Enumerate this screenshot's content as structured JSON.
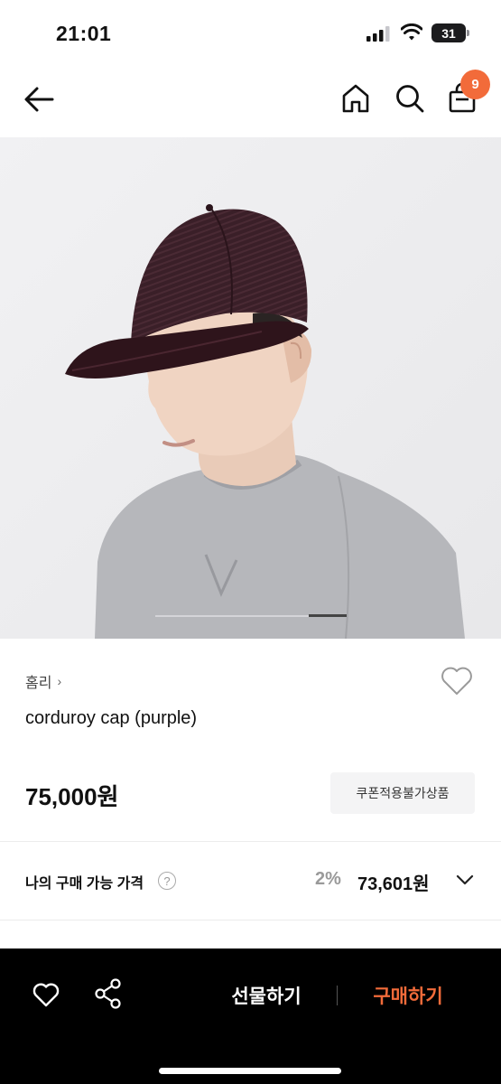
{
  "status_bar": {
    "time": "21:01",
    "battery": "31",
    "icons": [
      "signal-icon",
      "wifi-icon",
      "battery-icon"
    ]
  },
  "nav": {
    "icons": [
      "back-arrow-icon",
      "home-icon",
      "search-icon",
      "shopping-bag-icon"
    ],
    "cart_count": "9"
  },
  "hero": {
    "image": "model-wearing-purple-corduroy-cap",
    "carousel_position": 0.8
  },
  "product": {
    "shop_name": "홈리",
    "shop_chevron": "›",
    "title": "corduroy cap (purple)",
    "price": "75,000원",
    "coupon_badge": "쿠폰적용불가상품"
  },
  "my_price": {
    "label": "나의 구매 가능 가격",
    "help_icon": "?",
    "discount_rate": "2%",
    "price": "73,601원"
  },
  "bottom_bar": {
    "gift_label": "선물하기",
    "buy_label": "구매하기"
  },
  "colors": {
    "accent": "#f26b3a",
    "bottom_bar_bg": "#000000",
    "coupon_bg": "#f4f4f5",
    "discount_gray": "#9a9a9a"
  }
}
